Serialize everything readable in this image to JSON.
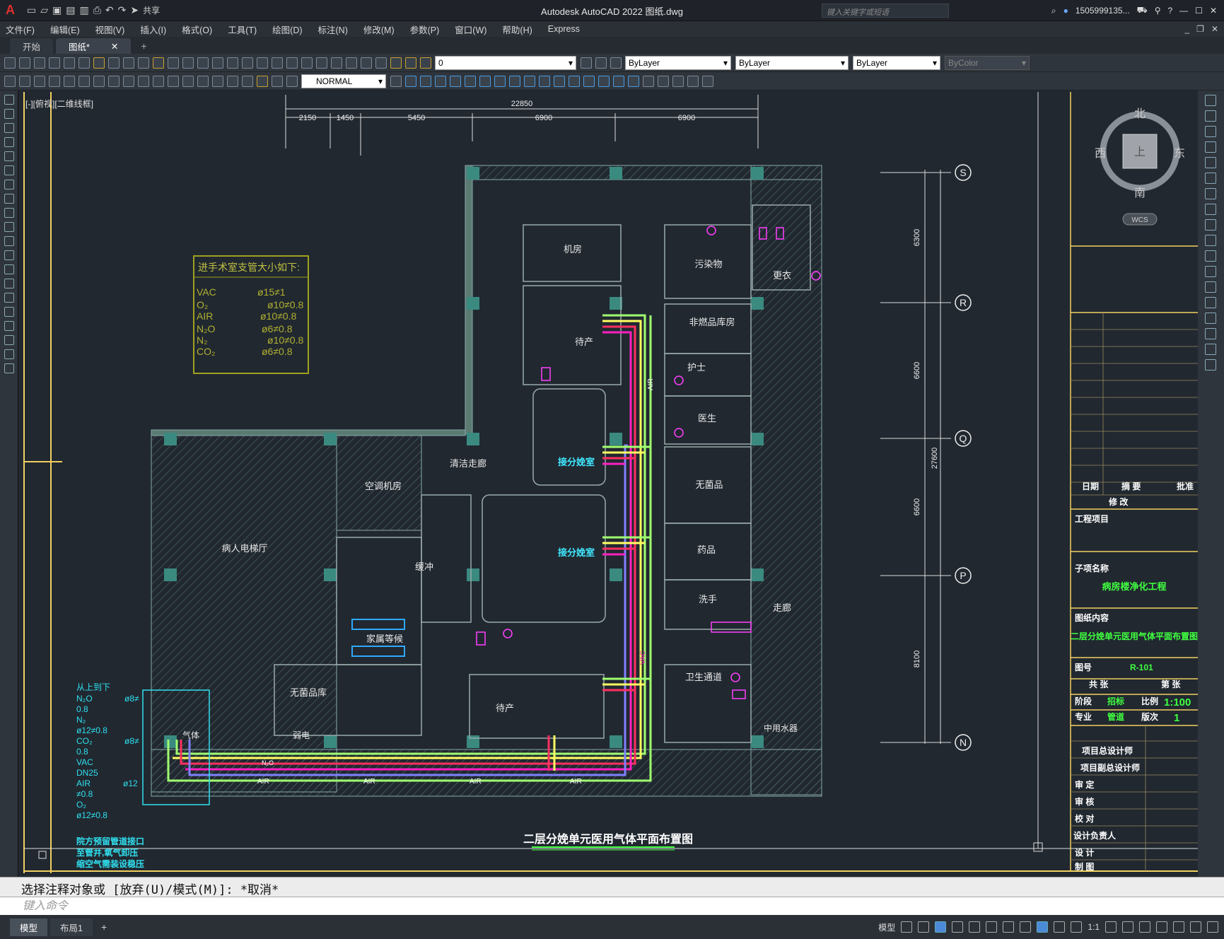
{
  "app": {
    "logo": "A",
    "title": "Autodesk AutoCAD 2022    图纸.dwg",
    "share": "共享",
    "search_placeholder": "键入关键字或短语",
    "user": "1505999135..."
  },
  "menu": [
    "文件(F)",
    "编辑(E)",
    "视图(V)",
    "插入(I)",
    "格式(O)",
    "工具(T)",
    "绘图(D)",
    "标注(N)",
    "修改(M)",
    "参数(P)",
    "窗口(W)",
    "帮助(H)",
    "Express"
  ],
  "tabs": [
    {
      "label": "开始"
    },
    {
      "label": "图纸*",
      "close": "✕"
    }
  ],
  "tab_add": "+",
  "toolbar": {
    "layer": "0",
    "color": "ByLayer",
    "linetype": "ByLayer",
    "lineweight": "ByLayer",
    "plotstyle": "ByColor",
    "dimstyle": "NORMAL"
  },
  "viewport_label": "[-][俯视][二维线框]",
  "viewcube": {
    "n": "北",
    "s": "南",
    "e": "东",
    "w": "西",
    "top": "上",
    "wcs": "WCS"
  },
  "dims_top": {
    "total": "22850",
    "parts": [
      "2150",
      "1450",
      "5450",
      "6900",
      "6900"
    ]
  },
  "dims_right": {
    "total": "27600",
    "parts": [
      "6300",
      "6600",
      "6600",
      "8100"
    ]
  },
  "grid_axes": [
    "S",
    "R",
    "Q",
    "P",
    "N"
  ],
  "rooms": {
    "jifang": "机房",
    "wuran": "污染物",
    "gengyi": "更衣",
    "feiran": "非燃品库房",
    "daichan": "待产",
    "hushi": "护士",
    "yisheng": "医生",
    "fenmian1": "接分娩室",
    "fenmian2": "接分娩室",
    "wujunpin": "无菌品",
    "yaopin": "药品",
    "xishou": "洗手",
    "qingjie": "清洁走廊",
    "kongtiao": "空调机房",
    "diantitng": "病人电梯厅",
    "huanchong": "缓冲",
    "jiashu": "家属等候",
    "wujun2": "无菌品库",
    "daichan2": "待产",
    "weisheng": "卫生通道",
    "zoulang": "走廊",
    "zhongyong": "中用水器",
    "ruodian": "弱电",
    "qiti": "气体"
  },
  "note_box": {
    "title": "进手术室支管大小如下:",
    "rows": [
      [
        "VAC",
        "ø15≠1"
      ],
      [
        "O₂",
        "ø10≠0.8"
      ],
      [
        "AIR",
        "ø10≠0.8"
      ],
      [
        "N₂O",
        "ø6≠0.8"
      ],
      [
        "N₂",
        "ø10≠0.8"
      ],
      [
        "CO₂",
        "ø6≠0.8"
      ]
    ]
  },
  "riser_box": {
    "title": "从上到下",
    "lines": [
      "N₂O",
      "0.8",
      "N₂",
      "ø12≠0.8",
      "CO₂",
      "0.8",
      "VAC",
      "DN25",
      "AIR",
      "≠0.8",
      "O₂",
      "ø12≠0.8"
    ],
    "side": [
      "ø8≠",
      "ø8≠",
      "ø12"
    ]
  },
  "riser_note": [
    "院方预留管道接口",
    "至管井,氧气卸压",
    "缩空气需装设稳压"
  ],
  "pipe_labels": [
    "AIR",
    "AIR",
    "AIR",
    "AIR",
    "AIR",
    "VAC",
    "N₂O"
  ],
  "drawing_title": "二层分娩单元医用气体平面布置图",
  "titleblock": {
    "date": "日期",
    "summary": "摘  要",
    "approve": "批准",
    "revise": "修  改",
    "project_label": "工程项目",
    "subproject_label": "子项名称",
    "subproject": "病房楼净化工程",
    "content_label": "图纸内容",
    "content": "二层分娩单元医用气体平面布置图",
    "drawing_no_label": "图号",
    "drawing_no": "R-101",
    "total": "共  张",
    "sheet": "第  张",
    "stage_label": "阶段",
    "stage": "招标",
    "scale_label": "比例",
    "scale": "1:100",
    "major_label": "专业",
    "major": "管道",
    "version_label": "版次",
    "version": "1",
    "roles": [
      "项目总设计师",
      "项目副总设计师",
      "审        定",
      "审        核",
      "校        对",
      "设计负责人",
      "设        计",
      "制        图"
    ]
  },
  "command": {
    "history": "选择注释对象或 [放弃(U)/模式(M)]: *取消*",
    "placeholder": "键入命令"
  },
  "layout_tabs": [
    "模型",
    "布局1"
  ],
  "layout_add": "+",
  "status": {
    "model": "模型",
    "scale": "1:1"
  }
}
